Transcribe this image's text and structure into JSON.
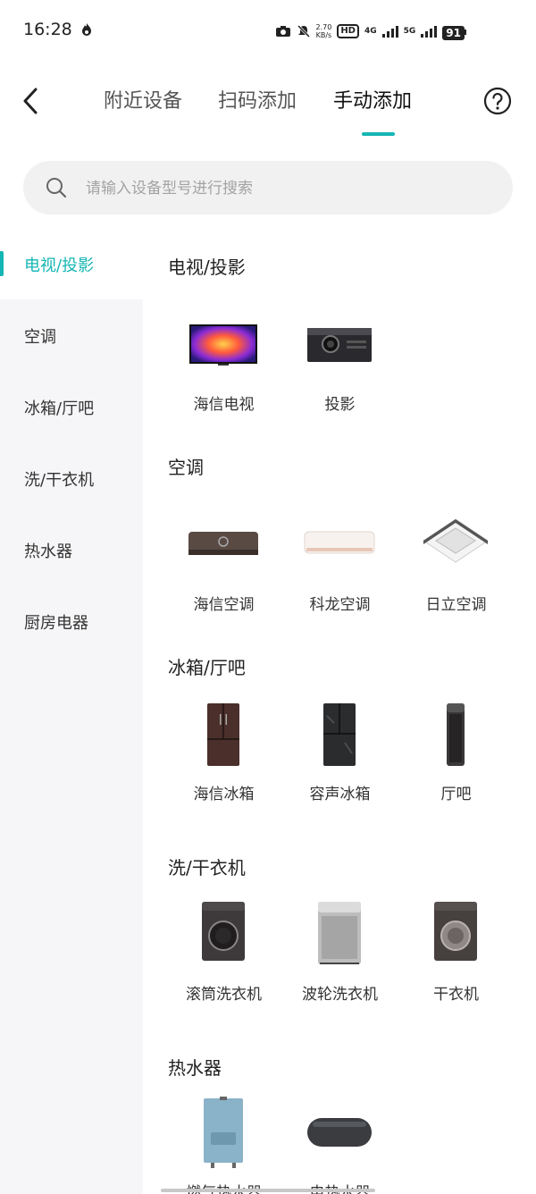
{
  "status_bar": {
    "time": "16:28",
    "net_speed_value": "2.70",
    "net_speed_unit": "KB/s",
    "hd_label": "HD",
    "sim1_label": "4G",
    "sim2_label": "5G",
    "battery": "91"
  },
  "header": {
    "tabs": [
      {
        "label": "附近设备"
      },
      {
        "label": "扫码添加"
      },
      {
        "label": "手动添加"
      }
    ],
    "help_label": "?"
  },
  "search": {
    "placeholder": "请输入设备型号进行搜索",
    "value": ""
  },
  "sidebar": {
    "items": [
      {
        "label": "电视/投影"
      },
      {
        "label": "空调"
      },
      {
        "label": "冰箱/厅吧"
      },
      {
        "label": "洗/干衣机"
      },
      {
        "label": "热水器"
      },
      {
        "label": "厨房电器"
      }
    ]
  },
  "sections": [
    {
      "title": "电视/投影",
      "devices": [
        {
          "name": "海信电视"
        },
        {
          "name": "投影"
        }
      ]
    },
    {
      "title": "空调",
      "devices": [
        {
          "name": "海信空调"
        },
        {
          "name": "科龙空调"
        },
        {
          "name": "日立空调"
        }
      ]
    },
    {
      "title": "冰箱/厅吧",
      "devices": [
        {
          "name": "海信冰箱"
        },
        {
          "name": "容声冰箱"
        },
        {
          "name": "厅吧"
        }
      ]
    },
    {
      "title": "洗/干衣机",
      "devices": [
        {
          "name": "滚筒洗衣机"
        },
        {
          "name": "波轮洗衣机"
        },
        {
          "name": "干衣机"
        }
      ]
    },
    {
      "title": "热水器",
      "devices": [
        {
          "name": "燃气热水器"
        },
        {
          "name": "电热水器"
        }
      ]
    }
  ],
  "colors": {
    "accent": "#14b6b4",
    "sidebar_bg": "#f6f6f8",
    "search_bg": "#f1f1f1"
  }
}
